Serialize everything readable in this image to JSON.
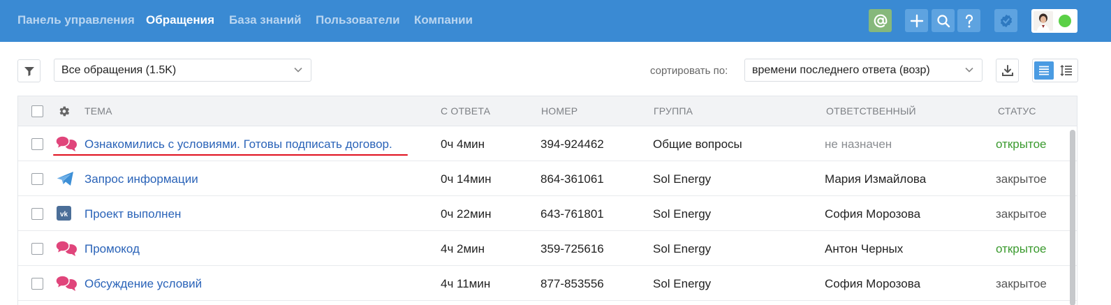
{
  "nav": {
    "items": [
      "Панель управления",
      "Обращения",
      "База знаний",
      "Пользователи",
      "Компании"
    ],
    "active_index": 1
  },
  "top_icons": [
    "mention-icon",
    "plus-icon",
    "search-icon",
    "help-icon",
    "check-badge-icon"
  ],
  "toolbar": {
    "view_select": "Все обращения (1.5K)",
    "sort_label": "сортировать по:",
    "sort_select": "времени последнего ответа (возр)"
  },
  "table": {
    "headers": [
      "ТЕМА",
      "С ОТВЕТА",
      "НОМЕР",
      "ГРУППА",
      "ОТВЕТСТВЕННЫЙ",
      "СТАТУС"
    ],
    "rows": [
      {
        "channel": "chat",
        "subject": "Ознакомились с условиями. Готовы подписать договор.",
        "since_reply": "0ч 4мин",
        "number": "394-924462",
        "group": "Общие вопросы",
        "assignee": "не назначен",
        "assignee_unassigned": true,
        "status": "открытое",
        "status_open": true
      },
      {
        "channel": "telegram",
        "subject": "Запрос информации",
        "since_reply": "0ч 14мин",
        "number": "864-361061",
        "group": "Sol Energy",
        "assignee": "Мария Измайлова",
        "assignee_unassigned": false,
        "status": "закрытое",
        "status_open": false
      },
      {
        "channel": "vk",
        "subject": "Проект выполнен",
        "since_reply": "0ч 22мин",
        "number": "643-761801",
        "group": "Sol Energy",
        "assignee": "София Морозова",
        "assignee_unassigned": false,
        "status": "закрытое",
        "status_open": false
      },
      {
        "channel": "chat",
        "subject": "Промокод",
        "since_reply": "4ч 2мин",
        "number": "359-725616",
        "group": "Sol Energy",
        "assignee": "Антон Черных",
        "assignee_unassigned": false,
        "status": "открытое",
        "status_open": true
      },
      {
        "channel": "chat",
        "subject": "Обсуждение условий",
        "since_reply": "4ч 11мин",
        "number": "877-853556",
        "group": "Sol Energy",
        "assignee": "София Морозова",
        "assignee_unassigned": false,
        "status": "закрытое",
        "status_open": false
      }
    ]
  },
  "colors": {
    "nav_bg": "#3a8ad3",
    "link": "#2a63b8",
    "status_open": "#3a9a2e",
    "status_closed": "#555555",
    "chat_icon": "#e0457b",
    "telegram_icon": "#3d8fd6",
    "vk_icon": "#4b6e98",
    "highlight_underline": "#e0101e"
  }
}
